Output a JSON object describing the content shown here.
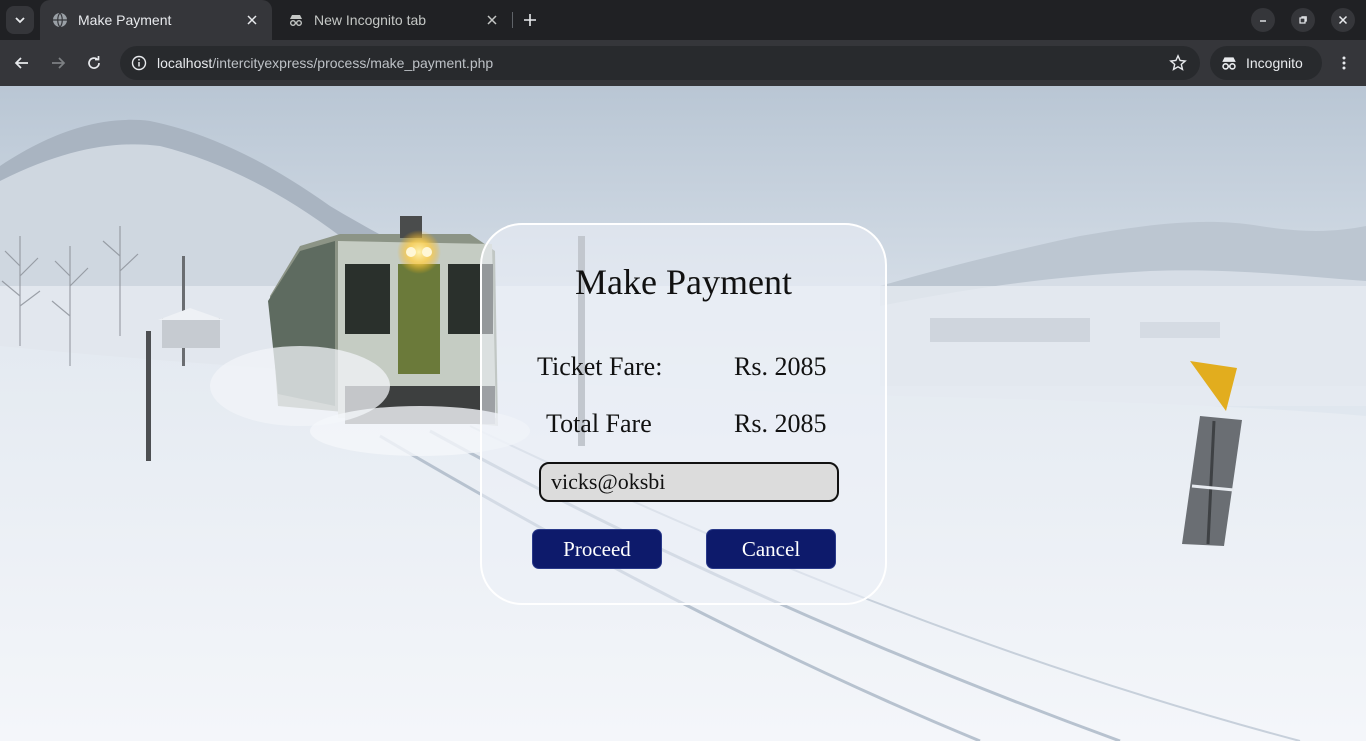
{
  "browser": {
    "tabs": [
      {
        "title": "Make Payment",
        "active": true
      },
      {
        "title": "New Incognito tab",
        "active": false
      }
    ],
    "url": {
      "host": "localhost",
      "path": "/intercityexpress/process/make_payment.php"
    },
    "profile_label": "Incognito"
  },
  "payment": {
    "heading": "Make Payment",
    "ticket_fare_label": "Ticket Fare:",
    "ticket_fare_value": "Rs. 2085",
    "total_fare_label": "Total Fare",
    "total_fare_value": "Rs. 2085",
    "upi_value": "vicks@oksbi",
    "proceed_label": "Proceed",
    "cancel_label": "Cancel"
  },
  "colors": {
    "button_bg": "#0d1a6b",
    "chrome_bg": "#202124",
    "toolbar_bg": "#35363a"
  }
}
